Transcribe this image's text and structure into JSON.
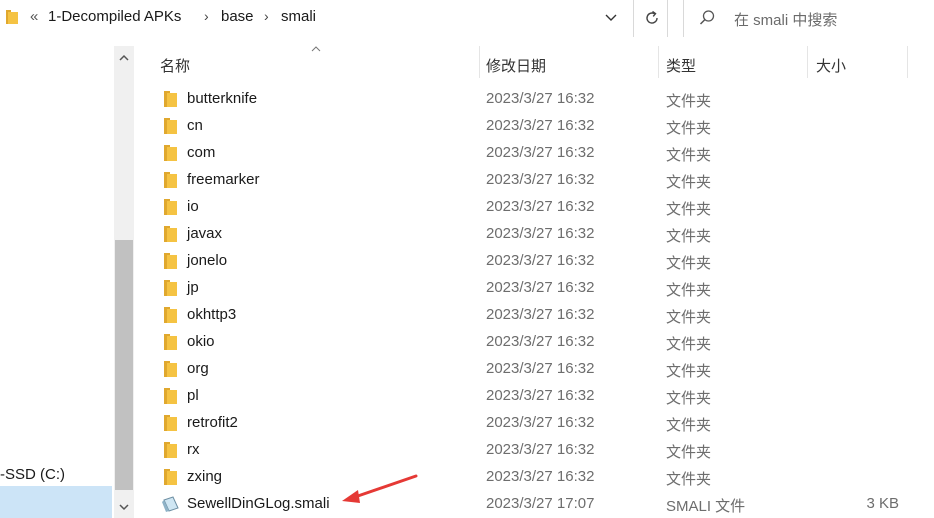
{
  "address_bar": {
    "overflow_glyph": "«",
    "breadcrumbs": [
      "1-Decompiled APKs",
      "base",
      "smali"
    ],
    "separator": "›"
  },
  "search": {
    "placeholder": "在 smali 中搜索"
  },
  "nav": {
    "drive_label": "-SSD (C:)"
  },
  "columns": {
    "name": "名称",
    "date": "修改日期",
    "type": "类型",
    "size": "大小"
  },
  "files": [
    {
      "name": "butterknife",
      "date": "2023/3/27 16:32",
      "type": "文件夹",
      "size": "",
      "icon": "folder-icon"
    },
    {
      "name": "cn",
      "date": "2023/3/27 16:32",
      "type": "文件夹",
      "size": "",
      "icon": "folder-icon"
    },
    {
      "name": "com",
      "date": "2023/3/27 16:32",
      "type": "文件夹",
      "size": "",
      "icon": "folder-icon"
    },
    {
      "name": "freemarker",
      "date": "2023/3/27 16:32",
      "type": "文件夹",
      "size": "",
      "icon": "folder-icon"
    },
    {
      "name": "io",
      "date": "2023/3/27 16:32",
      "type": "文件夹",
      "size": "",
      "icon": "folder-icon"
    },
    {
      "name": "javax",
      "date": "2023/3/27 16:32",
      "type": "文件夹",
      "size": "",
      "icon": "folder-icon"
    },
    {
      "name": "jonelo",
      "date": "2023/3/27 16:32",
      "type": "文件夹",
      "size": "",
      "icon": "folder-icon"
    },
    {
      "name": "jp",
      "date": "2023/3/27 16:32",
      "type": "文件夹",
      "size": "",
      "icon": "folder-icon"
    },
    {
      "name": "okhttp3",
      "date": "2023/3/27 16:32",
      "type": "文件夹",
      "size": "",
      "icon": "folder-icon"
    },
    {
      "name": "okio",
      "date": "2023/3/27 16:32",
      "type": "文件夹",
      "size": "",
      "icon": "folder-icon"
    },
    {
      "name": "org",
      "date": "2023/3/27 16:32",
      "type": "文件夹",
      "size": "",
      "icon": "folder-icon"
    },
    {
      "name": "pl",
      "date": "2023/3/27 16:32",
      "type": "文件夹",
      "size": "",
      "icon": "folder-icon"
    },
    {
      "name": "retrofit2",
      "date": "2023/3/27 16:32",
      "type": "文件夹",
      "size": "",
      "icon": "folder-icon"
    },
    {
      "name": "rx",
      "date": "2023/3/27 16:32",
      "type": "文件夹",
      "size": "",
      "icon": "folder-icon"
    },
    {
      "name": "zxing",
      "date": "2023/3/27 16:32",
      "type": "文件夹",
      "size": "",
      "icon": "folder-icon"
    },
    {
      "name": "SewellDinGLog.smali",
      "date": "2023/3/27 17:07",
      "type": "SMALI 文件",
      "size": "3 KB",
      "icon": "smali-file-icon"
    }
  ],
  "colors": {
    "folder": "#f5c343",
    "folder_dark": "#e0a82e",
    "selection": "#cce4f7",
    "annotation_arrow": "#e53935"
  },
  "annotation": {
    "icon": "red-arrow-icon",
    "points_to": "SewellDinGLog.smali"
  }
}
